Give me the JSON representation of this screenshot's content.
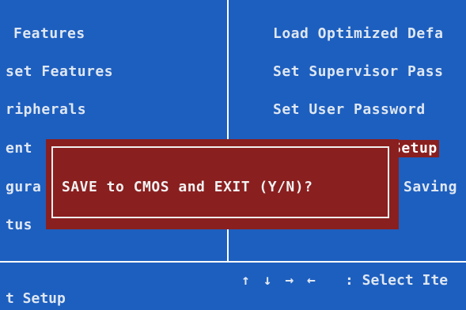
{
  "bios": {
    "left_menu": [
      "Features",
      "set Features",
      "ripherals",
      "ent",
      "gura",
      "tus"
    ],
    "right_menu": [
      "Load Optimized Defa",
      "Set Supervisor Pass",
      "Set User Password",
      "Setup",
      "Saving"
    ],
    "dialog": {
      "prompt": "SAVE to CMOS and EXIT (Y/N)?"
    },
    "footer": {
      "left_text": "t Setup",
      "arrows": "↑ ↓ → ←",
      "select_hint": ": Select Ite"
    },
    "colors": {
      "background": "#1d5fbf",
      "dialog": "#8a1f1f",
      "text": "#dfe7f2"
    }
  }
}
